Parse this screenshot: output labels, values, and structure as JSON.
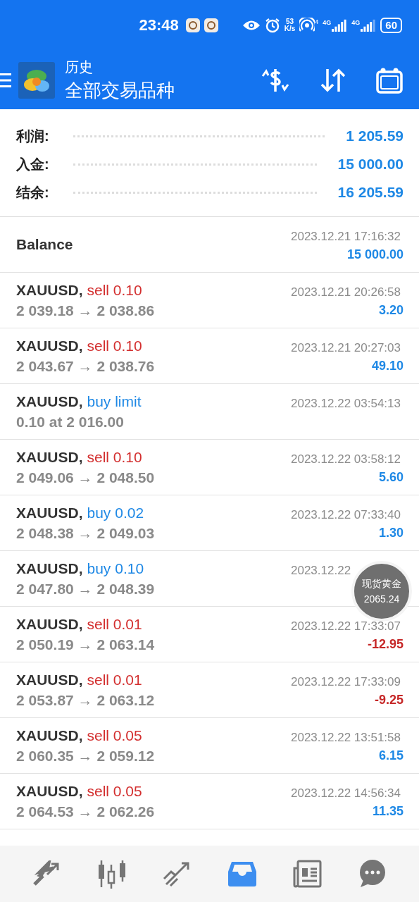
{
  "status_bar": {
    "time": "23:48",
    "speed_value": "53",
    "speed_unit": "K/s",
    "hotspot_badge": "4",
    "sim_labels": [
      "4G",
      "4G"
    ],
    "battery": "60"
  },
  "header": {
    "title": "历史",
    "subtitle": "全部交易品种"
  },
  "summary": [
    {
      "label": "利润:",
      "value": "1 205.59"
    },
    {
      "label": "入金:",
      "value": "15 000.00"
    },
    {
      "label": "结余:",
      "value": "16 205.59"
    }
  ],
  "rows": [
    {
      "kind": "balance",
      "title": "Balance",
      "time": "2023.12.21 17:16:32",
      "amount": "15 000.00",
      "loss": false
    },
    {
      "kind": "trade",
      "symbol": "XAUUSD,",
      "side": "sell 0.10",
      "color": "#d32f2f",
      "detail": "2 039.18 → 2 038.86",
      "time": "2023.12.21 20:26:58",
      "amount": "3.20",
      "loss": false
    },
    {
      "kind": "trade",
      "symbol": "XAUUSD,",
      "side": "sell 0.10",
      "color": "#d32f2f",
      "detail": "2 043.67 → 2 038.76",
      "time": "2023.12.21 20:27:03",
      "amount": "49.10",
      "loss": false
    },
    {
      "kind": "trade",
      "symbol": "XAUUSD,",
      "side": "buy limit",
      "color": "#1e88e5",
      "detail": "0.10 at 2 016.00",
      "time": "2023.12.22 03:54:13"
    },
    {
      "kind": "trade",
      "symbol": "XAUUSD,",
      "side": "sell 0.10",
      "color": "#d32f2f",
      "detail": "2 049.06 → 2 048.50",
      "time": "2023.12.22 03:58:12",
      "amount": "5.60",
      "loss": false
    },
    {
      "kind": "trade",
      "symbol": "XAUUSD,",
      "side": "buy 0.02",
      "color": "#1e88e5",
      "detail": "2 048.38 → 2 049.03",
      "time": "2023.12.22 07:33:40",
      "amount": "1.30",
      "loss": false
    },
    {
      "kind": "trade",
      "symbol": "XAUUSD,",
      "side": "buy 0.10",
      "color": "#1e88e5",
      "detail": "2 047.80 → 2 048.39",
      "time": "2023.12.22"
    },
    {
      "kind": "trade",
      "symbol": "XAUUSD,",
      "side": "sell 0.01",
      "color": "#d32f2f",
      "detail": "2 050.19 → 2 063.14",
      "time": "2023.12.22 17:33:07",
      "amount": "-12.95",
      "loss": true
    },
    {
      "kind": "trade",
      "symbol": "XAUUSD,",
      "side": "sell 0.01",
      "color": "#d32f2f",
      "detail": "2 053.87 → 2 063.12",
      "time": "2023.12.22 17:33:09",
      "amount": "-9.25",
      "loss": true
    },
    {
      "kind": "trade",
      "symbol": "XAUUSD,",
      "side": "sell 0.05",
      "color": "#d32f2f",
      "detail": "2 060.35 → 2 059.12",
      "time": "2023.12.22 13:51:58",
      "amount": "6.15",
      "loss": false
    },
    {
      "kind": "trade",
      "symbol": "XAUUSD,",
      "side": "sell 0.05",
      "color": "#d32f2f",
      "detail": "2 064.53 → 2 062.26",
      "time": "2023.12.22 14:56:34",
      "amount": "11.35",
      "loss": false
    }
  ],
  "quote_bubble": {
    "name": "现货黄金",
    "price": "2065.24"
  },
  "nav": [
    {
      "kind": "trade",
      "selected": false
    },
    {
      "kind": "quotes",
      "selected": false
    },
    {
      "kind": "chart",
      "selected": false
    },
    {
      "kind": "history",
      "selected": true
    },
    {
      "kind": "news",
      "selected": false
    },
    {
      "kind": "chat",
      "selected": false
    }
  ]
}
